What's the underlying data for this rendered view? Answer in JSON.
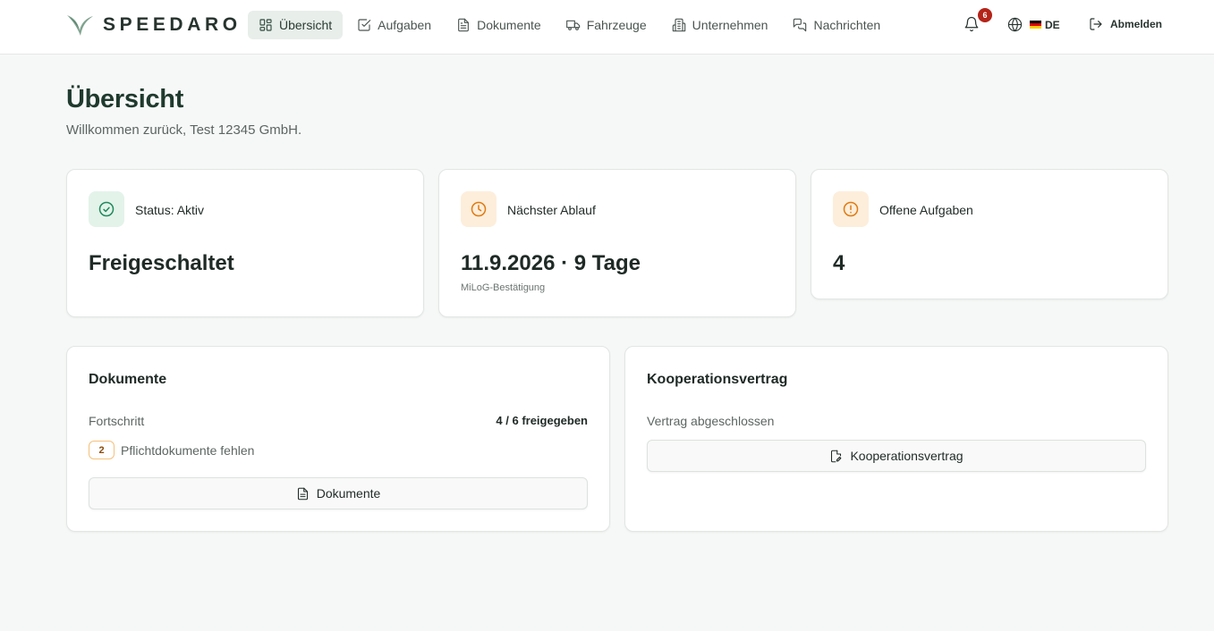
{
  "app": {
    "brand": "SPEEDARO"
  },
  "nav": {
    "items": [
      {
        "label": "Übersicht",
        "icon": "dashboard-icon",
        "active": true
      },
      {
        "label": "Aufgaben",
        "icon": "checkbox-icon",
        "active": false
      },
      {
        "label": "Dokumente",
        "icon": "document-icon",
        "active": false
      },
      {
        "label": "Fahrzeuge",
        "icon": "truck-icon",
        "active": false
      },
      {
        "label": "Unternehmen",
        "icon": "building-icon",
        "active": false
      },
      {
        "label": "Nachrichten",
        "icon": "messages-icon",
        "active": false
      }
    ]
  },
  "header": {
    "notification_count": "6",
    "language_code": "DE",
    "logout_label": "Abmelden"
  },
  "page": {
    "title": "Übersicht",
    "subtitle": "Willkommen zurück, Test 12345 GmbH."
  },
  "stats": [
    {
      "label": "Status: Aktiv",
      "value": "Freigeschaltet",
      "sub": "",
      "icon": "check-circle-icon",
      "color": "#1f8a5b",
      "bg": "#e3f3ea"
    },
    {
      "label": "Nächster Ablauf",
      "value": "11.9.2026 · 9 Tage",
      "sub": "MiLoG-Bestätigung",
      "icon": "clock-icon",
      "color": "#e07a12",
      "bg": "#fdeedb"
    },
    {
      "label": "Offene Aufgaben",
      "value": "4",
      "sub": "",
      "icon": "alert-circle-icon",
      "color": "#e07a12",
      "bg": "#fdeedb"
    }
  ],
  "documents_panel": {
    "title": "Dokumente",
    "progress_label": "Fortschritt",
    "progress_value": "4 / 6 freigegeben",
    "missing_count": "2",
    "missing_text": "Pflichtdokumente fehlen",
    "button_label": "Dokumente"
  },
  "contract_panel": {
    "title": "Kooperationsvertrag",
    "status_text": "Vertrag abgeschlossen",
    "button_label": "Kooperationsvertrag"
  },
  "colors": {
    "accent": "#2f4a3d",
    "badge": "#b42318",
    "warning": "#e07a12",
    "success": "#1f8a5b"
  }
}
